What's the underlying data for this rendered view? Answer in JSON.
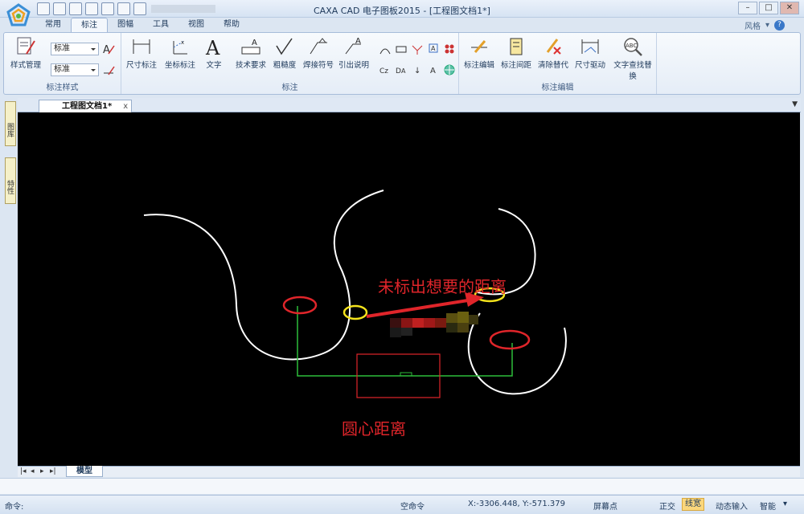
{
  "titlebar": {
    "title": "CAXA CAD 电子图板2015 - [工程图文档1*]",
    "min": "–",
    "max": "□",
    "close": "✕"
  },
  "tabs": [
    "常用",
    "标注",
    "图幅",
    "工具",
    "视图",
    "帮助"
  ],
  "active_tab_index": 1,
  "style_area": {
    "label": "风格",
    "help": "?"
  },
  "ribbon": {
    "groups": [
      {
        "label": "标注样式",
        "buttons": [
          "样式管理"
        ],
        "combos": [
          "标准",
          "标准"
        ]
      },
      {
        "label": "标注",
        "buttons": [
          "尺寸标注",
          "坐标标注",
          "文字",
          "技术要求",
          "粗糙度",
          "焊接符号",
          "引出说明"
        ]
      },
      {
        "label": "标注编辑",
        "buttons": [
          "标注编辑",
          "标注间距",
          "清除替代",
          "尺寸驱动",
          "文字查找替换"
        ]
      }
    ]
  },
  "side_panels": [
    "图库",
    "特性"
  ],
  "document_tab": {
    "label": "工程图文档1*",
    "close": "x"
  },
  "canvas": {
    "annotation_top": "未标出想要的距离",
    "annotation_bottom": "圆心距离"
  },
  "bottom_tabs": {
    "model": "模型"
  },
  "command": {
    "label": "命令:"
  },
  "status": {
    "empty_cmd": "空命令",
    "coords": "X:-3306.448, Y:-571.379",
    "screen_snap": "屏幕点",
    "ortho": "正交",
    "lineweight": "线宽",
    "dyn_input": "动态输入",
    "smart": "智能"
  }
}
